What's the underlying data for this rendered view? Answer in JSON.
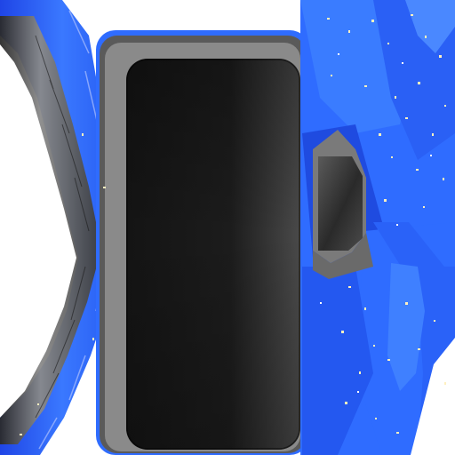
{
  "texture": {
    "colors": {
      "background": "#ffffff",
      "blue_primary": "#2f6cff",
      "blue_dark": "#1f3fd0",
      "blue_light": "#6fa0ff",
      "fleck_light": "#fff0c0",
      "fleck_bright": "#ffffff",
      "screen_dark": "#141414",
      "screen_mid": "#3a3a3a",
      "metal_light": "#bdbdbd",
      "metal_mid": "#7a7a7a",
      "metal_dark": "#3f3f3f"
    }
  }
}
